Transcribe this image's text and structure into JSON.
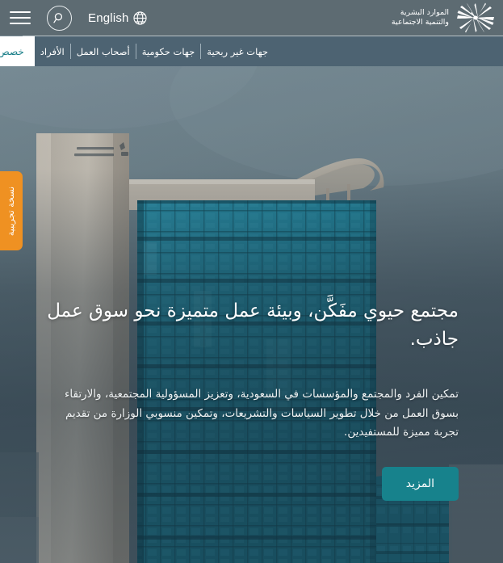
{
  "header": {
    "menu_icon": "hamburger-menu-icon",
    "search_icon": "search-icon",
    "language_label": "English",
    "globe_icon": "globe-icon",
    "logo": {
      "line1": "الموارد البشرية",
      "line2": "والتنمية الاجتماعية",
      "emblem_icon": "palm-star-emblem-icon"
    }
  },
  "nav": {
    "items": [
      {
        "label": "جهات غير ربحية",
        "active": false
      },
      {
        "label": "جهات حكومية",
        "active": false
      },
      {
        "label": "أصحاب العمل",
        "active": false
      },
      {
        "label": "الأفراد",
        "active": false
      },
      {
        "label": "خصص تجربتك",
        "active": true
      }
    ]
  },
  "beta_tab": {
    "label": "نسخة تجريبية"
  },
  "hero": {
    "title": "مجتمع حيوي مفَكَّن، وبيئة عمل متميزة نحو سوق عمل جاذب.",
    "description": "تمكين الفرد والمجتمع والمؤسسات في السعودية، وتعزيز المسؤولية المجتمعية، والارتقاء بسوق العمل من خلال تطوير السياسات والتشريعات، وتمكين منسوبي الوزارة من تقديم تجربة مميزة للمستفيدين.",
    "button_label": "المزيد",
    "image_alt": "مبنى وزارة الموارد البشرية والتنمية الاجتماعية"
  },
  "colors": {
    "header_bg": "#5d6b72",
    "nav_bg": "#4d6372",
    "accent_teal": "#17828c",
    "beta_orange": "#ef9122",
    "active_tab_text": "#1b7f89",
    "white": "#ffffff"
  }
}
